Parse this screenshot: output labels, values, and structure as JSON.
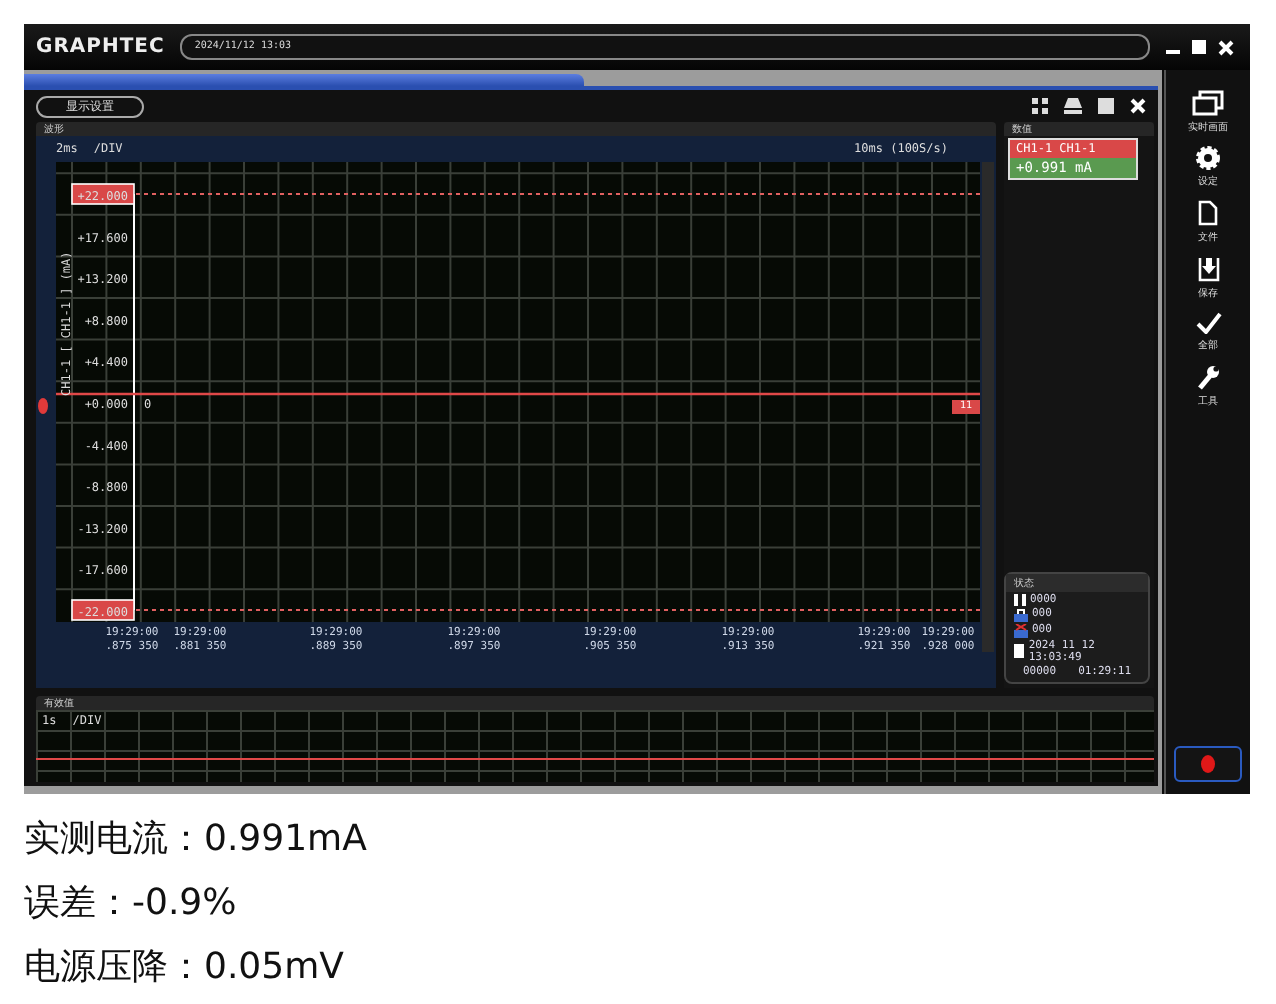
{
  "app": {
    "logo": "GRAPHTEC",
    "title_field": "2024/11/12 13:03"
  },
  "toolbar": {
    "button": "显示设置"
  },
  "chart_panel": {
    "title": "波形",
    "timebase": "2ms",
    "div_unit": "/DIV",
    "sample_rate": "10ms (100S/s)",
    "axis_title": "CH1-1 [ CH1-1 ] (mA)",
    "zero_marker": "0",
    "right_marker": "11",
    "y_labels": [
      "+22.000",
      "+17.600",
      "+13.200",
      "+8.800",
      "+4.400",
      "+0.000",
      "-4.400",
      "-8.800",
      "-13.200",
      "-17.600",
      "-22.000"
    ],
    "time_labels": [
      {
        "time": "19:29:00",
        "fraction": ".875 350"
      },
      {
        "time": "19:29:00",
        "fraction": ".881 350"
      },
      {
        "time": "19:29:00",
        "fraction": ".889 350"
      },
      {
        "time": "19:29:00",
        "fraction": ".897 350"
      },
      {
        "time": "19:29:00",
        "fraction": ".905 350"
      },
      {
        "time": "19:29:00",
        "fraction": ".913 350"
      },
      {
        "time": "19:29:00",
        "fraction": ".921 350"
      },
      {
        "time": "19:29:00",
        "fraction": ".928 000"
      }
    ]
  },
  "value_panel": {
    "title": "数值",
    "channel": "CH1-1 CH1-1",
    "reading": "+0.991 mA"
  },
  "status_panel": {
    "title": "状态",
    "rows": [
      {
        "kind": "pause",
        "text": "0000"
      },
      {
        "kind": "lock",
        "text": "000"
      },
      {
        "kind": "alarm",
        "text": "000"
      },
      {
        "kind": "file",
        "text": "2024 11 12 13:03:49"
      }
    ],
    "count": "00000",
    "elapsed": "01:29:11"
  },
  "bottom_panel": {
    "title": "有效值",
    "timebase": "1s",
    "div_unit": "/DIV"
  },
  "sidebar": [
    {
      "kind": "windows",
      "label": "实时画面"
    },
    {
      "kind": "gear",
      "label": "设定"
    },
    {
      "kind": "file",
      "label": "文件"
    },
    {
      "kind": "save",
      "label": "保存"
    },
    {
      "kind": "check",
      "label": "全部"
    },
    {
      "kind": "wrench",
      "label": "工具"
    }
  ],
  "captions": [
    "实测电流：0.991mA",
    "误差：-0.9%",
    "电源压降：0.05mV"
  ]
}
